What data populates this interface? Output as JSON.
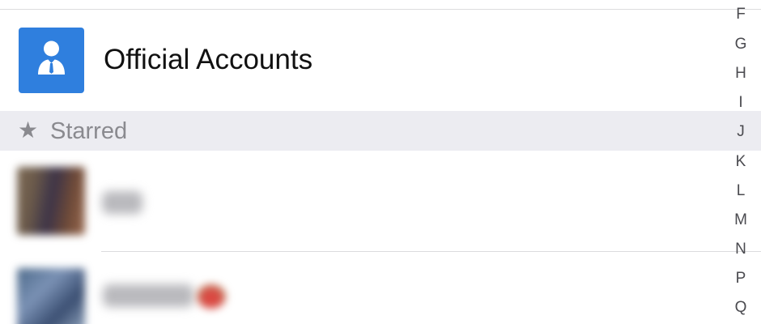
{
  "official_accounts": {
    "label": "Official Accounts",
    "icon": "official-account-icon",
    "icon_color": "#2f7fde"
  },
  "starred_section": {
    "icon": "★",
    "label": "Starred"
  },
  "index_bar": {
    "letters": [
      "F",
      "G",
      "H",
      "I",
      "J",
      "K",
      "L",
      "M",
      "N",
      "P",
      "Q"
    ]
  }
}
